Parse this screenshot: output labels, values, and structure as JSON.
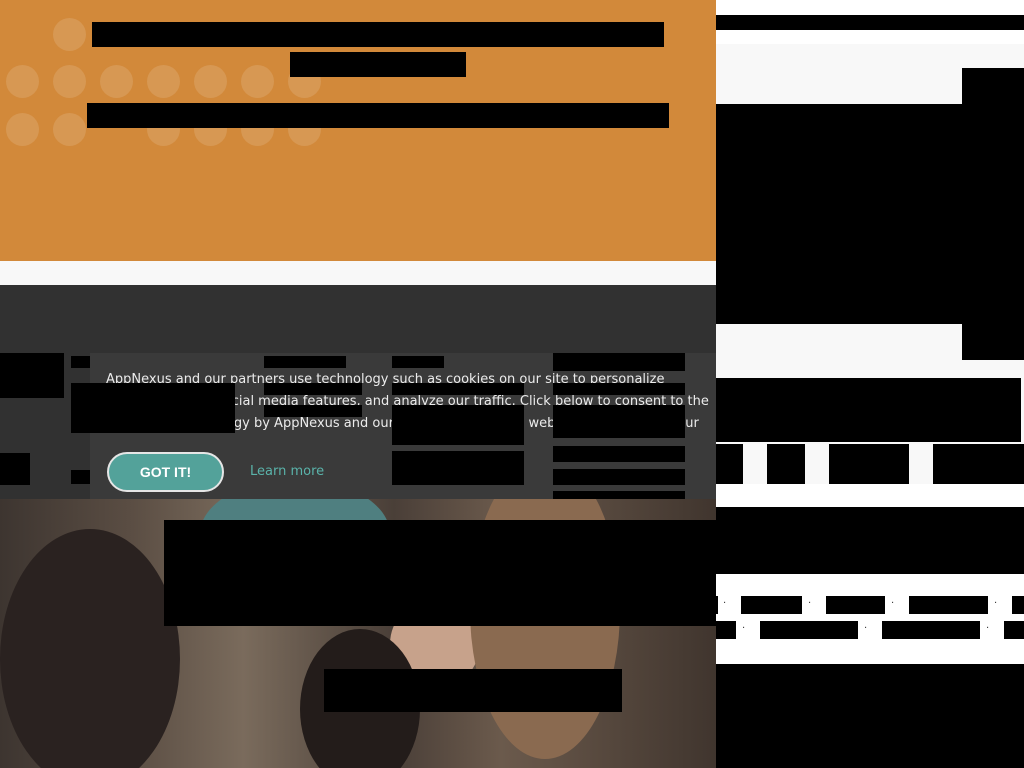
{
  "cookie_banner": {
    "message": "AppNexus and our partners use technology such as cookies on our site to personalize content, provide social media features, and analyze our traffic. Click below to consent to the use of this technology by AppNexus and our partners across the web. You can change your mind and revisit your consent choices at any time by returning to this site.",
    "accept_label": "GOT IT!",
    "learn_more_label": "Learn more"
  },
  "colors": {
    "hero_background": "#d2893a",
    "footer_background": "#313131",
    "banner_background": "#3a3a3a",
    "accept_button": "#53a29a",
    "learn_more_link": "#5ab3aa"
  },
  "icons": [
    "dot-pattern"
  ]
}
